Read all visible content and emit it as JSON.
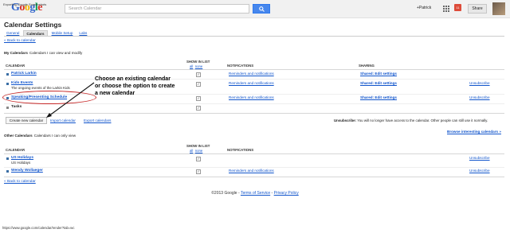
{
  "header": {
    "logo_overlay": "Exporting Google Screenshots",
    "search_placeholder": "Search Calendar",
    "user": "+Patrick",
    "notif_count": "11",
    "share_label": "Share"
  },
  "page": {
    "title": "Calendar Settings",
    "tabs": [
      {
        "label": "General"
      },
      {
        "label": "Calendars"
      },
      {
        "label": "Mobile Setup"
      },
      {
        "label": "Labs"
      }
    ],
    "back_link": "« Back to calendar"
  },
  "my_calendars": {
    "title": "My Calendars",
    "subtitle": "Calendars I can view and modify",
    "headers": {
      "calendar": "CALENDAR",
      "show_in_list": "SHOW IN LIST",
      "all": "all",
      "none": "none",
      "notifications": "NOTIFICATIONS",
      "sharing": "SHARING"
    },
    "rows": [
      {
        "name": "Patrick Larkin",
        "desc": "",
        "notifications": "Reminders and notifications",
        "sharing": "Shared: Edit settings",
        "unsubscribe": "",
        "color": "#3a6ea5"
      },
      {
        "name": "Kids Events",
        "desc": "The ongoing events of the Larkin Kids",
        "notifications": "Reminders and notifications",
        "sharing": "Shared: Edit settings",
        "unsubscribe": "Unsubscribe",
        "color": "#3a6ea5"
      },
      {
        "name": "Speaking/Presenting Schedule",
        "desc": "",
        "notifications": "Reminders and notifications",
        "sharing": "Shared: Edit settings",
        "unsubscribe": "Unsubscribe",
        "color": "#3a6ea5"
      },
      {
        "name": "Tasks",
        "desc": "",
        "notifications": "",
        "sharing": "",
        "unsubscribe": "",
        "color": "#888888"
      }
    ],
    "buttons": {
      "create": "Create new calendar",
      "import": "Import calendar",
      "export": "Export calendars"
    },
    "unsub_note_bold": "Unsubscribe:",
    "unsub_note": "You will no longer have access to the calendar. Other people can still use it normally."
  },
  "browse_link": "Browse interesting calendars »",
  "other_calendars": {
    "title": "Other Calendars",
    "subtitle": "Calendars I can only view",
    "headers": {
      "calendar": "CALENDAR",
      "show_in_list": "SHOW IN LIST",
      "all": "all",
      "none": "none",
      "notifications": "NOTIFICATIONS"
    },
    "rows": [
      {
        "name": "US Holidays",
        "desc": "US Holidays",
        "notifications": "",
        "unsubscribe": "Unsubscribe",
        "color": "#3a6ea5"
      },
      {
        "name": "Wendy Wollaeger",
        "desc": "",
        "notifications": "Reminders and notifications",
        "unsubscribe": "Unsubscribe",
        "color": "#3a6ea5"
      }
    ]
  },
  "back_link_bottom": "« Back to calendar",
  "footer": {
    "copyright": "©2013 Google - ",
    "terms": "Terms of Service",
    "sep": " - ",
    "privacy": "Privacy Policy"
  },
  "status_url": "https://www.google.com/calendar/render?tab=wc",
  "annotation": {
    "line1": "Choose an existing calendar",
    "line2": "or choose the option to create",
    "line3": "a new calendar"
  }
}
